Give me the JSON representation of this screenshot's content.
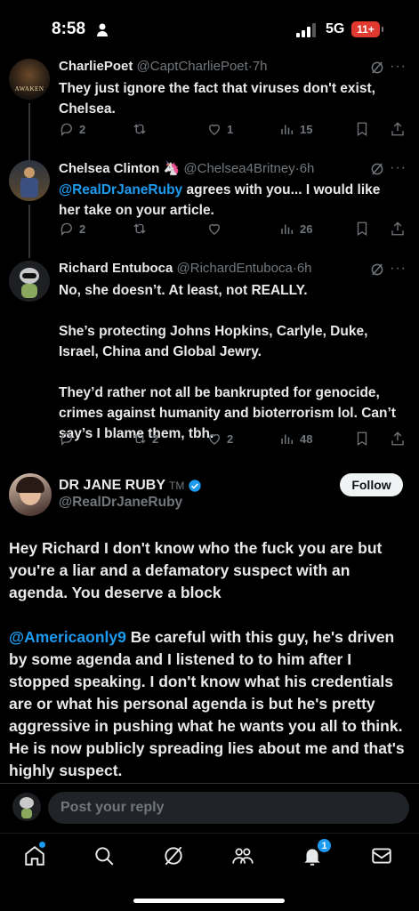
{
  "status": {
    "time": "8:58",
    "network": "5G",
    "battery": "11+"
  },
  "thread": [
    {
      "name": "CharliePoet",
      "handle": "@CaptCharliePoet",
      "time": "7h",
      "avatar_text": "AWAKEN",
      "text": "They just ignore the fact that viruses don't exist, Chelsea.",
      "replies": "2",
      "reposts": "",
      "likes": "1",
      "views": "15"
    },
    {
      "name": "Chelsea Clinton",
      "name_emoji": "🦄",
      "handle": "@Chelsea4Britney",
      "time": "6h",
      "mention": "@RealDrJaneRuby",
      "text": " agrees with you... I would like her take on your article.",
      "replies": "2",
      "reposts": "",
      "likes": "",
      "views": "26"
    },
    {
      "name": "Richard Entuboca",
      "handle": "@RichardEntuboca",
      "time": "6h",
      "paragraphs": [
        "No, she doesn’t. At least, not REALLY.",
        "She’s protecting Johns Hopkins, Carlyle, Duke, Israel, China and Global Jewry.",
        "They’d rather not all be bankrupted for genocide, crimes against humanity and bioterrorism lol. Can’t say’s I blame them, tbh."
      ],
      "replies": "",
      "reposts": "2",
      "likes": "2",
      "views": "48"
    }
  ],
  "main_tweet": {
    "name": "DR JANE RUBY",
    "name_suffix": "TM",
    "handle": "@RealDrJaneRuby",
    "follow_label": "Follow",
    "paragraph1": "Hey Richard I don't know who the fuck you are but you're a liar and a defamatory suspect with an agenda.  You deserve a block",
    "mention": "@Americaonly9",
    "paragraph2": " Be careful with this guy, he's driven by some agenda and I listened to to him after I stopped speaking. I don't know what his credentials are or what his personal agenda is but he's pretty aggressive in pushing what he wants you all to think. He is now publicly spreading lies about me and that's highly suspect."
  },
  "reply_bar": {
    "placeholder": "Post your reply"
  },
  "tabs": [
    "home-icon",
    "search-icon",
    "grok-icon",
    "communities-icon",
    "notifications-icon",
    "messages-icon"
  ],
  "notification_count": "1",
  "colors": {
    "accent": "#1d9bf0",
    "muted": "#71767b",
    "text": "#e7e9ea",
    "background": "#000000"
  }
}
